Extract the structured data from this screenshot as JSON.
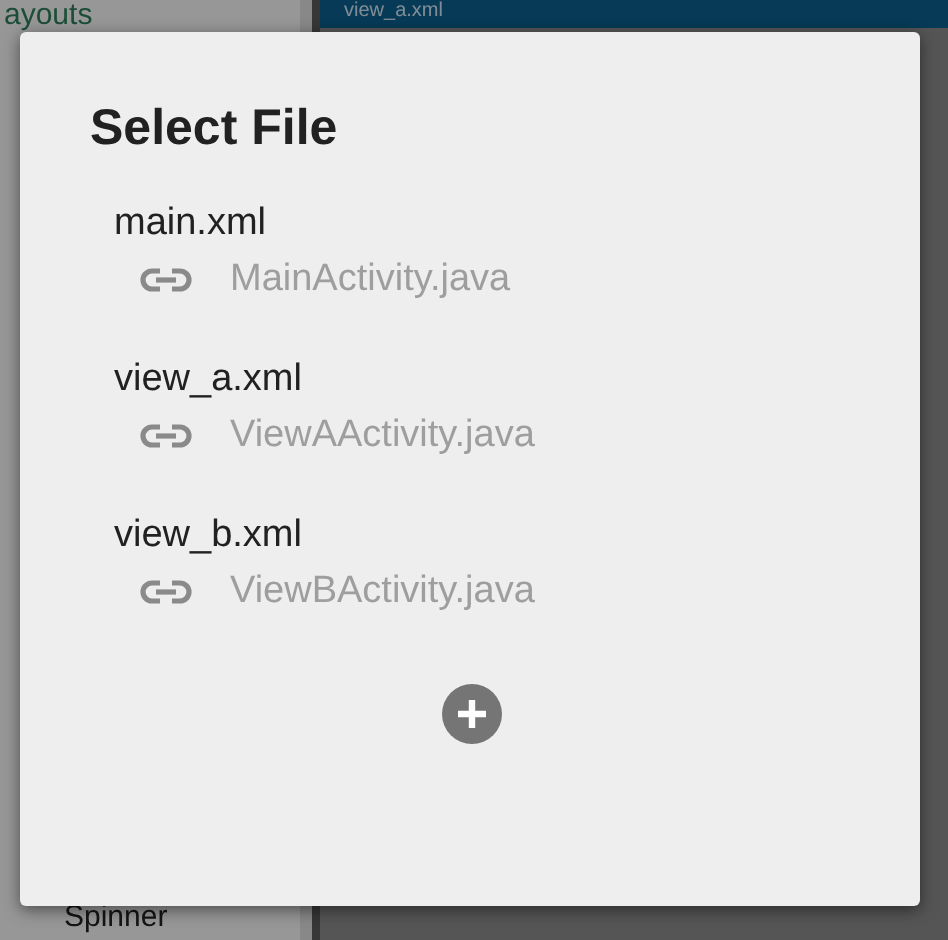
{
  "background": {
    "sidebar_heading": "ayouts",
    "tab_title": "view_a.xml",
    "sidebar_item": "Spinner"
  },
  "dialog": {
    "title": "Select File",
    "files": [
      {
        "name": "main.xml",
        "linked": "MainActivity.java"
      },
      {
        "name": "view_a.xml",
        "linked": "ViewAActivity.java"
      },
      {
        "name": "view_b.xml",
        "linked": "ViewBActivity.java"
      }
    ]
  }
}
